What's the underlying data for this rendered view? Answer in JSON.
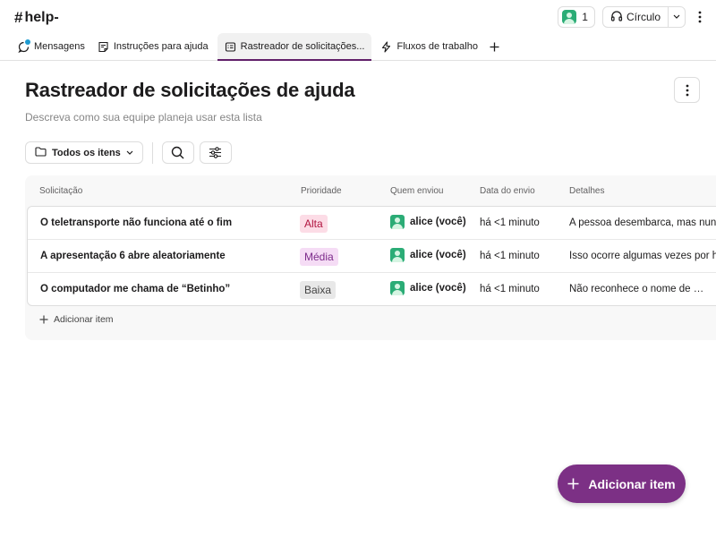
{
  "header": {
    "hash": "#",
    "channel": "help-",
    "member_count": "1",
    "huddle_label": "Círculo"
  },
  "tabs": [
    {
      "label": "Mensagens",
      "icon": "message-icon"
    },
    {
      "label": "Instruções para ajuda",
      "icon": "canvas-icon"
    },
    {
      "label": "Rastreador de solicitações...",
      "icon": "list-icon",
      "active": true
    },
    {
      "label": "Fluxos de trabalho",
      "icon": "lightning-icon"
    }
  ],
  "page": {
    "title": "Rastreador de solicitações de ajuda",
    "description": "Descreva como sua equipe planeja usar esta lista"
  },
  "toolbar": {
    "view_label": "Todos os itens"
  },
  "table": {
    "columns": [
      "Solicitação",
      "Prioridade",
      "Quem enviou",
      "Data do envio",
      "Detalhes"
    ],
    "rows": [
      {
        "request": "O teletransporte não funciona até o fim",
        "priority": "Alta",
        "submitter": "alice (você)",
        "date": "há <1 minuto",
        "details": "A pessoa desembarca, mas nunc"
      },
      {
        "request": "A apresentação 6 abre aleatoriamente",
        "priority": "Média",
        "submitter": "alice (você)",
        "date": "há <1 minuto",
        "details": "Isso ocorre algumas vezes por ho"
      },
      {
        "request": "O computador me chama de “Betinho”",
        "priority": "Baixa",
        "submitter": "alice (você)",
        "date": "há <1 minuto",
        "details": "Não reconhece o nome de …"
      }
    ],
    "add_item_label": "Adicionar item"
  },
  "priority_colors": {
    "Alta": {
      "bg": "#fcdce6",
      "fg": "#b1143f"
    },
    "Média": {
      "bg": "#f5dcf5",
      "fg": "#7c2a8a"
    },
    "Baixa": {
      "bg": "#e8e8e8",
      "fg": "#454545"
    }
  },
  "fab": {
    "label": "Adicionar item",
    "color": "#7c3085"
  }
}
